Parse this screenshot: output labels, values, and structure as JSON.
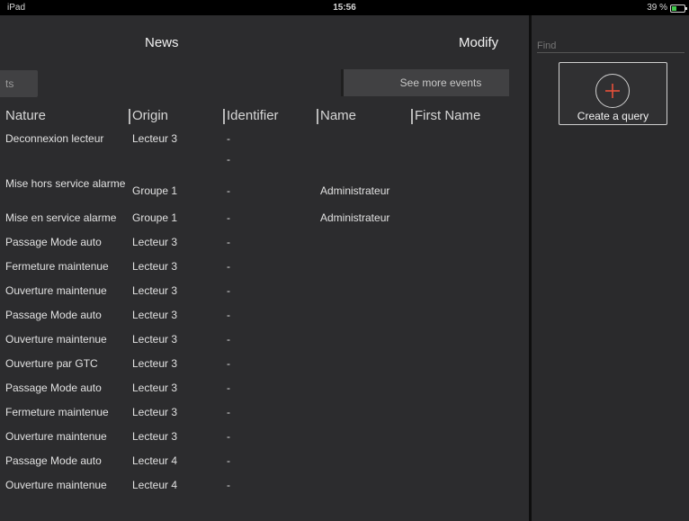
{
  "status_bar": {
    "device": "iPad",
    "time": "15:56",
    "battery_text": "39 %",
    "battery_level": 0.39,
    "battery_color": "#3ec94a"
  },
  "nav": {
    "title": "News",
    "modify": "Modify"
  },
  "toolbar": {
    "left_button": "ts",
    "see_more": "See more events"
  },
  "table": {
    "headers": [
      "Nature",
      "Origin",
      "Identifier",
      "Name",
      "First Name"
    ],
    "rows": [
      {
        "nature": "Deconnexion lecteur",
        "origin": "Lecteur 3",
        "identifier": "-",
        "name": "",
        "first_name": ""
      },
      {
        "nature": "",
        "origin": "",
        "identifier": "-",
        "name": "",
        "first_name": ""
      },
      {
        "nature": "Mise hors service alarme",
        "origin": "Groupe 1",
        "identifier": "-",
        "name": "Administrateur",
        "first_name": ""
      },
      {
        "nature": "Mise en service alarme",
        "origin": "Groupe 1",
        "identifier": "-",
        "name": "Administrateur",
        "first_name": ""
      },
      {
        "nature": "Passage Mode auto",
        "origin": "Lecteur 3",
        "identifier": "-",
        "name": "",
        "first_name": ""
      },
      {
        "nature": "Fermeture maintenue",
        "origin": "Lecteur 3",
        "identifier": "-",
        "name": "",
        "first_name": ""
      },
      {
        "nature": "Ouverture maintenue",
        "origin": "Lecteur 3",
        "identifier": "-",
        "name": "",
        "first_name": ""
      },
      {
        "nature": "Passage Mode auto",
        "origin": "Lecteur 3",
        "identifier": "-",
        "name": "",
        "first_name": ""
      },
      {
        "nature": "Ouverture maintenue",
        "origin": "Lecteur 3",
        "identifier": "-",
        "name": "",
        "first_name": ""
      },
      {
        "nature": "Ouverture par GTC",
        "origin": "Lecteur 3",
        "identifier": "-",
        "name": "",
        "first_name": ""
      },
      {
        "nature": "Passage Mode auto",
        "origin": "Lecteur 3",
        "identifier": "-",
        "name": "",
        "first_name": ""
      },
      {
        "nature": "Fermeture maintenue",
        "origin": "Lecteur 3",
        "identifier": "-",
        "name": "",
        "first_name": ""
      },
      {
        "nature": "Ouverture maintenue",
        "origin": "Lecteur 3",
        "identifier": "-",
        "name": "",
        "first_name": ""
      },
      {
        "nature": "Passage Mode auto",
        "origin": "Lecteur 4",
        "identifier": "-",
        "name": "",
        "first_name": ""
      },
      {
        "nature": "Ouverture maintenue",
        "origin": "Lecteur 4",
        "identifier": "-",
        "name": "",
        "first_name": ""
      }
    ]
  },
  "sidebar": {
    "search_placeholder": "Find",
    "create_query": "Create a query",
    "accent_color": "#e8503a",
    "plus_icon": "plus-circle-icon"
  }
}
